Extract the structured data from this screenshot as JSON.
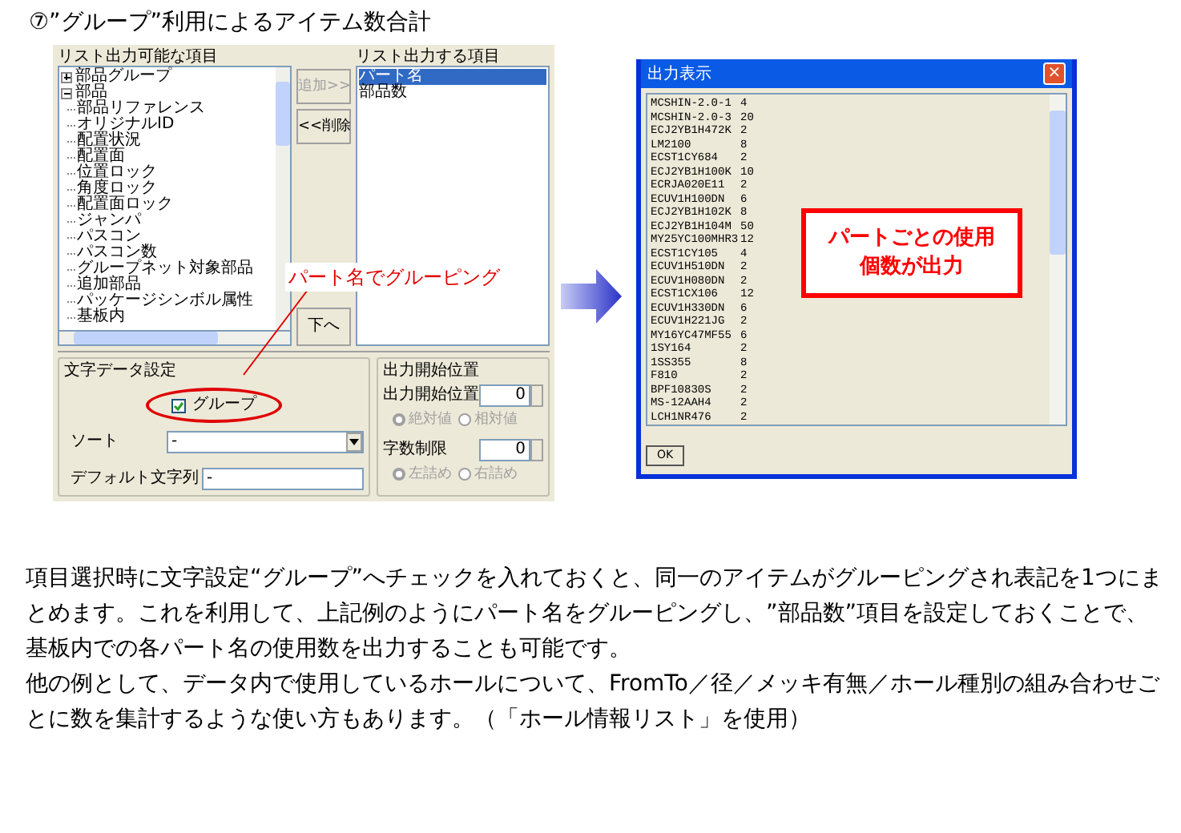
{
  "heading": "⑦”グループ”利用によるアイテム数合計",
  "dialog": {
    "available_label": "リスト出力可能な項目",
    "tree": [
      {
        "label": "部品グループ",
        "expanded": false
      },
      {
        "label": "部品",
        "expanded": true,
        "children": [
          {
            "label": "部品リファレンス"
          },
          {
            "label": "オリジナルID"
          },
          {
            "label": "配置状況"
          },
          {
            "label": "配置面"
          },
          {
            "label": "位置ロック"
          },
          {
            "label": "角度ロック"
          },
          {
            "label": "配置面ロック"
          },
          {
            "label": "ジャンパ"
          },
          {
            "label": "パスコン"
          },
          {
            "label": "パスコン数"
          },
          {
            "label": "グループネット対象部品"
          },
          {
            "label": "追加部品"
          },
          {
            "label": "パッケージシンボル属性"
          },
          {
            "label": "基板内"
          }
        ]
      }
    ],
    "buttons": [
      {
        "label": "追加>>",
        "disabled": true
      },
      {
        "label": "<<削除",
        "disabled": false
      }
    ],
    "down_button": "下へ",
    "output_label": "リスト出力する項目",
    "output_items": [
      {
        "label": "パート名",
        "selected": true
      },
      {
        "label": "部品数",
        "selected": false
      }
    ],
    "text_group": {
      "title": "文字データ設定",
      "group_checkbox": {
        "label": "グループ",
        "checked": true
      },
      "sort_label": "ソート",
      "sort_value": "-",
      "default_label": "デフォルト文字列",
      "default_value": "-"
    },
    "start_group": {
      "title": "出力開始位置",
      "start_label": "出力開始位置",
      "start_value": "0",
      "radios1": [
        {
          "label": "絶対値",
          "selected": true,
          "disabled": true
        },
        {
          "label": "相対値",
          "selected": false,
          "disabled": true
        }
      ],
      "limit_label": "字数制限",
      "limit_value": "0",
      "radios2": [
        {
          "label": "左詰め",
          "selected": true,
          "disabled": true
        },
        {
          "label": "右詰め",
          "selected": false,
          "disabled": true
        }
      ]
    }
  },
  "callout": "パート名でグルーピング",
  "output_window": {
    "title": "出力表示",
    "close": "×",
    "rows": [
      {
        "name": "MCSHIN-2.0-1",
        "count": "4"
      },
      {
        "name": "MCSHIN-2.0-3",
        "count": "20"
      },
      {
        "name": "ECJ2YB1H472K",
        "count": "2"
      },
      {
        "name": "LM2100",
        "count": "8"
      },
      {
        "name": "ECST1CY684",
        "count": "2"
      },
      {
        "name": "ECJ2YB1H100K",
        "count": "10"
      },
      {
        "name": "ECRJA020E11",
        "count": "2"
      },
      {
        "name": "ECUV1H100DN",
        "count": "6"
      },
      {
        "name": "ECJ2YB1H102K",
        "count": "8"
      },
      {
        "name": "ECJ2YB1H104M",
        "count": "50"
      },
      {
        "name": "MY25YC100MHR3",
        "count": "12"
      },
      {
        "name": "ECST1CY105",
        "count": "4"
      },
      {
        "name": "ECUV1H510DN",
        "count": "2"
      },
      {
        "name": "ECUV1H080DN",
        "count": "2"
      },
      {
        "name": "ECST1CX106",
        "count": "12"
      },
      {
        "name": "ECUV1H330DN",
        "count": "6"
      },
      {
        "name": "ECUV1H221JG",
        "count": "2"
      },
      {
        "name": "MY16YC47MF55",
        "count": "6"
      },
      {
        "name": "1SY164",
        "count": "2"
      },
      {
        "name": "1SS355",
        "count": "8"
      },
      {
        "name": "F810",
        "count": "2"
      },
      {
        "name": "BPF10830S",
        "count": "2"
      },
      {
        "name": "MS-12AAH4",
        "count": "2"
      },
      {
        "name": "LCH1NR476",
        "count": "2"
      }
    ],
    "ok": "OK"
  },
  "note": [
    "パートごとの使用",
    "個数が出力"
  ],
  "paragraphs": [
    "項目選択時に文字設定“グループ”へチェックを入れておくと、同一のアイテムがグルーピングされ表記を1つにまとめます。これを利用して、上記例のようにパート名をグルーピングし、”部品数”項目を設定しておくことで、基板内での各パート名の使用数を出力することも可能です。",
    "他の例として、データ内で使用しているホールについて、FromTo／径／メッキ有無／ホール種別の組み合わせごとに数を集計するような使い方もあります。（「ホール情報リスト」を使用）"
  ]
}
